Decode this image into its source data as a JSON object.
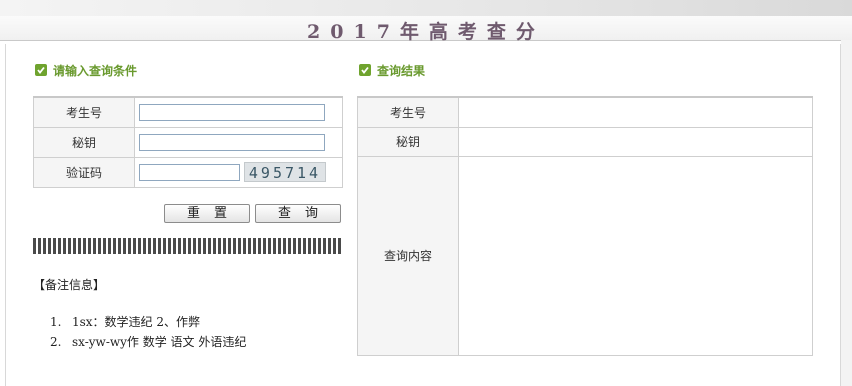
{
  "page": {
    "title": "2017年高考查分"
  },
  "query_section": {
    "heading": "请输入查询条件",
    "fields": [
      {
        "label": "考生号",
        "value": ""
      },
      {
        "label": "秘钥",
        "value": ""
      },
      {
        "label": "验证码",
        "value": "",
        "captcha": "495714"
      }
    ],
    "reset_label": "重置",
    "query_label": "查询"
  },
  "notes": {
    "title": "【备注信息】",
    "items": [
      {
        "num": "1.",
        "text": "1sx：数学违纪  2、作弊"
      },
      {
        "num": "2.",
        "text": "sx-yw-wy作  数学  语文  外语违纪"
      }
    ]
  },
  "result_section": {
    "heading": "查询结果",
    "rows": [
      {
        "label": "考生号",
        "value": ""
      },
      {
        "label": "秘钥",
        "value": ""
      },
      {
        "label": "查询内容",
        "value": ""
      }
    ]
  },
  "colors": {
    "accent": "#6a9a2f",
    "title": "#6f5a6e",
    "input_border": "#8fa7bf"
  }
}
